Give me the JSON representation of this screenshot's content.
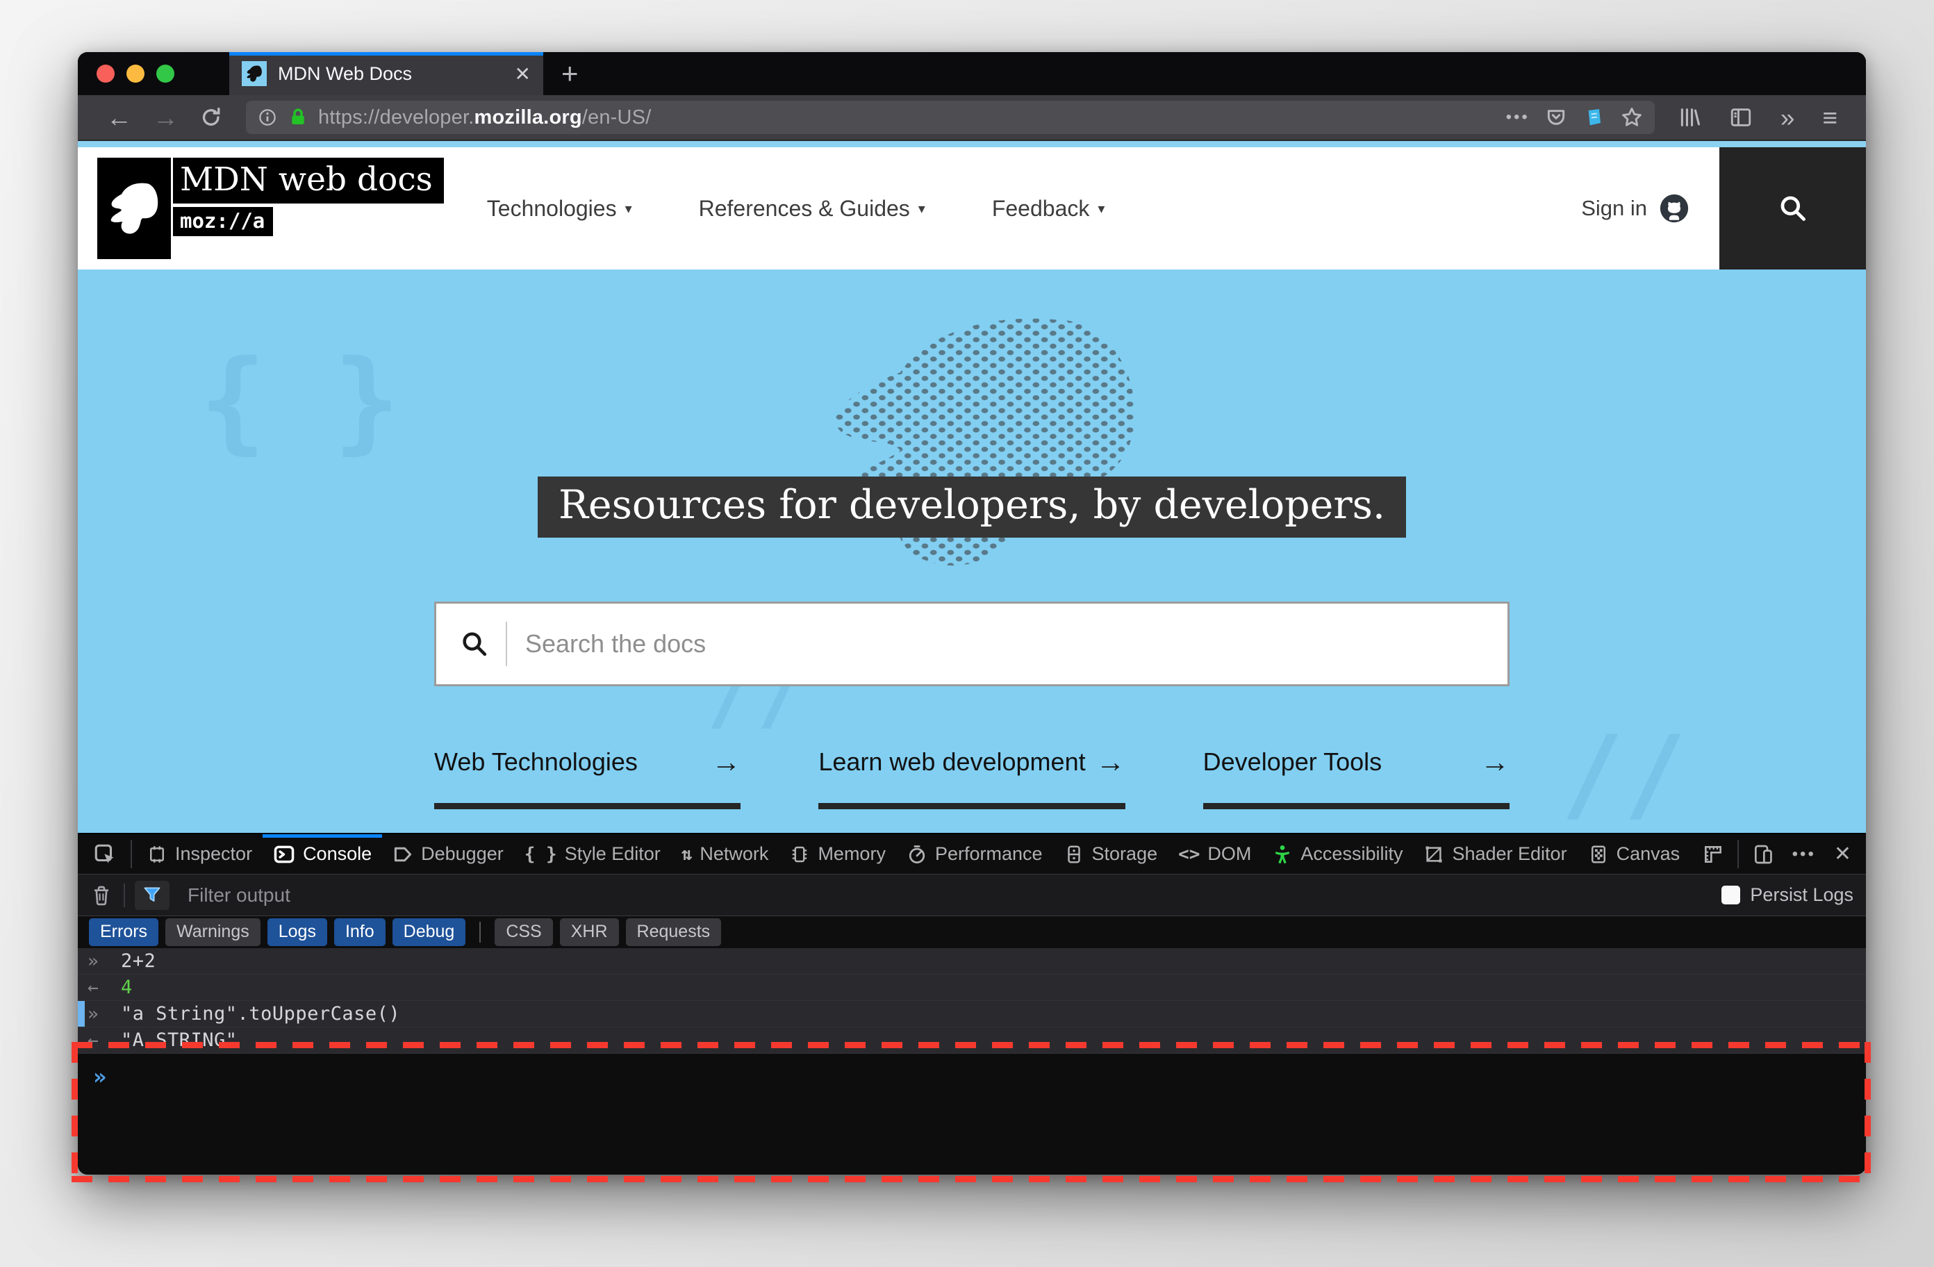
{
  "browser": {
    "tab": {
      "title": "MDN Web Docs",
      "close_glyph": "✕",
      "new_tab_glyph": "+"
    },
    "url": {
      "prefix": "https://developer.",
      "domain": "mozilla.org",
      "path": "/en-US/"
    },
    "glyphs": {
      "back": "←",
      "forward": "→",
      "meatballs": "•••",
      "overflow": "»",
      "hamburger": "≡"
    }
  },
  "mdn": {
    "logo_title": "MDN web docs",
    "logo_wordmark": "moz://a",
    "nav_caret": "▾",
    "nav": [
      {
        "label": "Technologies"
      },
      {
        "label": "References & Guides"
      },
      {
        "label": "Feedback"
      }
    ],
    "sign_in": "Sign in",
    "hero": {
      "title": "Resources for developers, by developers.",
      "search_placeholder": "Search the docs",
      "link_arrow": "→",
      "ghost_glyph_braces": "{ }",
      "ghost_glyph_slashes": "//",
      "links": [
        {
          "label": "Web Technologies"
        },
        {
          "label": "Learn web development"
        },
        {
          "label": "Developer Tools"
        }
      ]
    }
  },
  "devtools": {
    "active_tab": "Console",
    "tabs": [
      {
        "label": "Inspector"
      },
      {
        "label": "Console"
      },
      {
        "label": "Debugger"
      },
      {
        "label": "Style Editor"
      },
      {
        "label": "Network"
      },
      {
        "label": "Memory"
      },
      {
        "label": "Performance"
      },
      {
        "label": "Storage"
      },
      {
        "label": "DOM"
      },
      {
        "label": "Accessibility"
      },
      {
        "label": "Shader Editor"
      },
      {
        "label": "Canvas"
      }
    ],
    "tab_glyphs": {
      "style_editor": "{ }",
      "network": "⇅",
      "dom": "<>"
    },
    "toolbar_glyphs": {
      "meatballs": "•••",
      "close": "✕"
    },
    "filter": {
      "placeholder": "Filter output",
      "persist_label": "Persist Logs"
    },
    "filter_buttons": [
      {
        "label": "Errors",
        "active": true
      },
      {
        "label": "Warnings",
        "active": false
      },
      {
        "label": "Logs",
        "active": true
      },
      {
        "label": "Info",
        "active": true
      },
      {
        "label": "Debug",
        "active": true
      },
      {
        "label": "CSS",
        "active": false
      },
      {
        "label": "XHR",
        "active": false
      },
      {
        "label": "Requests",
        "active": false
      }
    ],
    "console": {
      "rows": [
        {
          "prompt": "»",
          "text": "2+2"
        },
        {
          "prompt": "←",
          "text": "4"
        },
        {
          "prompt": "»",
          "text": "\"a String\".toUpperCase()"
        },
        {
          "prompt": "←",
          "text": "\"A STRING\""
        }
      ],
      "input_prompt": "»"
    }
  },
  "colors": {
    "accent_blue": "#0a84ff",
    "hero_blue": "#82cff2",
    "filter_active_blue": "#1e5299",
    "result_green": "#61d14b",
    "highlight_red": "#f5392f",
    "lock_green": "#23c226"
  }
}
